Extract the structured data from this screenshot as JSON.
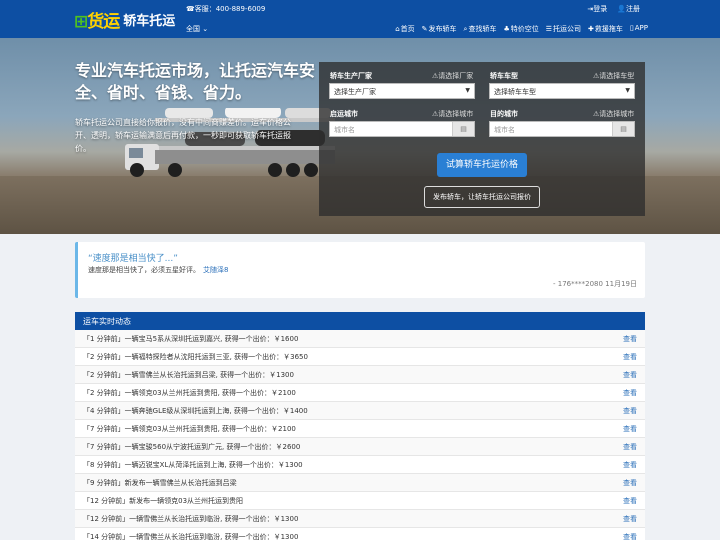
{
  "header": {
    "logo_main": "货运",
    "logo_sub": "轿车托运",
    "hotline": "☎客服：400-889-6009",
    "city": "全国",
    "login": "登录",
    "register": "注册",
    "nav": [
      {
        "icon": "⌂",
        "label": "首页"
      },
      {
        "icon": "✎",
        "label": "发布轿车"
      },
      {
        "icon": "⌕",
        "label": "查找轿车"
      },
      {
        "icon": "♣",
        "label": "特价空位"
      },
      {
        "icon": "☰",
        "label": "托运公司"
      },
      {
        "icon": "✚",
        "label": "救援拖车"
      },
      {
        "icon": "▯",
        "label": "APP"
      }
    ]
  },
  "hero": {
    "title": "专业汽车托运市场，让托运汽车安全、省时、省钱、省力。",
    "desc": "轿车托运公司直接给你报价，没有中间商赚差价。运车价格公开、透明，轿车运输满意后再付款，一秒即可获取轿车托运报价。"
  },
  "form": {
    "maker_label": "轿车生产厂家",
    "maker_hint": "⚠请选择厂家",
    "maker_value": "选择生产厂家",
    "model_label": "轿车车型",
    "model_hint": "⚠请选择车型",
    "model_value": "选择轿车车型",
    "from_label": "启运城市",
    "from_hint": "⚠请选择城市",
    "from_placeholder": "城市名",
    "to_label": "目的城市",
    "to_hint": "⚠请选择城市",
    "to_placeholder": "城市名",
    "calc_button": "试算轿车托运价格",
    "post_button": "发布轿车，让轿车托运公司报价"
  },
  "testimonial": {
    "quote": "“速度那是相当快了...”",
    "body": "速度那是相当快了，必须五星好评。",
    "author": "艾随泽8",
    "meta": "- 176****2080",
    "date": "11月19日"
  },
  "feed": {
    "title": "运车实时动态",
    "view_label": "查看",
    "rows": [
      "「1 分钟前」一辆宝马5系从深圳托运到嘉兴, 获得一个出价：￥1600",
      "「2 分钟前」一辆福特探险者从沈阳托运到三亚, 获得一个出价：￥3650",
      "「2 分钟前」一辆雪佛兰从长治托运到吕梁, 获得一个出价：￥1300",
      "「2 分钟前」一辆领克03从兰州托运到贵阳, 获得一个出价：￥2100",
      "「4 分钟前」一辆奔驰GLE级从深圳托运到上海, 获得一个出价：￥1400",
      "「7 分钟前」一辆领克03从兰州托运到贵阳, 获得一个出价：￥2100",
      "「7 分钟前」一辆宝骏560从宁波托运到广元, 获得一个出价：￥2600",
      "「8 分钟前」一辆迈锐宝XL从菏泽托运到上海, 获得一个出价：￥1300",
      "「9 分钟前」新发布一辆雪佛兰从长治托运到吕梁",
      "「12 分钟前」新发布一辆领克03从兰州托运到贵阳",
      "「12 分钟前」一辆雪佛兰从长治托运到临汾, 获得一个出价：￥1300",
      "「14 分钟前」一辆雪佛兰从长治托运到临汾, 获得一个出价：￥1300"
    ]
  }
}
